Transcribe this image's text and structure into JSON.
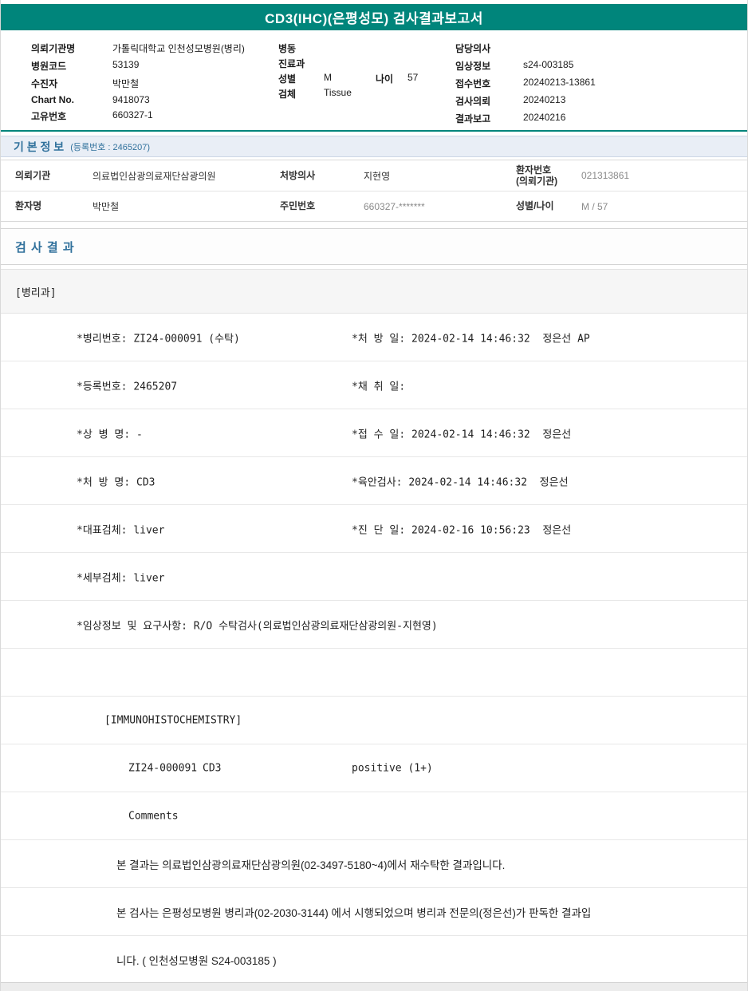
{
  "header": {
    "title": "CD3(IHC)(은평성모) 검사결과보고서",
    "accent_color": "#00857B"
  },
  "info": {
    "left": [
      {
        "label": "의뢰기관명",
        "value": "가톨릭대학교 인천성모병원(병리)"
      },
      {
        "label": "병원코드",
        "value": "53139"
      },
      {
        "label": "수진자",
        "value": "박만철"
      },
      {
        "label": "Chart No.",
        "value": "9418073"
      },
      {
        "label": "고유번호",
        "value": "660327-1"
      }
    ],
    "middle": [
      {
        "label": "병동",
        "value": ""
      },
      {
        "label": "진료과",
        "value": ""
      },
      {
        "label": "성별",
        "value": "M",
        "label2": "나이",
        "value2": "57"
      },
      {
        "label": "검체",
        "value": "Tissue"
      }
    ],
    "right": [
      {
        "label": "담당의사",
        "value": ""
      },
      {
        "label": "임상정보",
        "value": "s24-003185"
      },
      {
        "label": "접수번호",
        "value": "20240213-13861"
      },
      {
        "label": "검사의뢰",
        "value": "20240213"
      },
      {
        "label": "결과보고",
        "value": "20240216"
      }
    ]
  },
  "basic_info": {
    "title": "기 본 정 보",
    "subtitle": "(등록번호 : 2465207)",
    "rows": [
      [
        {
          "label": "의뢰기관",
          "value": "의료법인삼광의료재단삼광의원"
        },
        {
          "label": "처방의사",
          "value": "지현영"
        },
        {
          "label": "환자번호\n(의뢰기관)",
          "value": "021313861"
        }
      ],
      [
        {
          "label": "환자명",
          "value": "박만철"
        },
        {
          "label": "주민번호",
          "value": "660327-*******"
        },
        {
          "label": "성별/나이",
          "value": "M / 57"
        }
      ]
    ]
  },
  "results": {
    "title": "검 사 결 과",
    "department": "[병리과]",
    "detail_rows": [
      {
        "left": "*병리번호: ZI24-000091 (수탁)",
        "right": "*처 방 일: 2024-02-14 14:46:32  정은선 AP"
      },
      {
        "left": "*등록번호: 2465207",
        "right": "*채 취 일:"
      },
      {
        "left": "*상 병 명: -",
        "right": "*접 수 일: 2024-02-14 14:46:32  정은선"
      },
      {
        "left": "*처 방 명: CD3",
        "right": "*육안검사: 2024-02-14 14:46:32  정은선"
      },
      {
        "left": "*대표검체: liver",
        "right": "*진 단 일: 2024-02-16 10:56:23  정은선"
      },
      {
        "left": "*세부검체: liver",
        "right": ""
      },
      {
        "left": "*임상정보 및 요구사항: R/O 수탁검사(의료법인삼광의료재단삼광의원-지현영)",
        "right": ""
      },
      {
        "left": "",
        "right": ""
      }
    ],
    "section_label": "[IMMUNOHISTOCHEMISTRY]",
    "result_line": {
      "specimen": "ZI24-000091",
      "test": "CD3",
      "result": "positive (1+)"
    },
    "comments_label": "Comments",
    "comment_lines": [
      "본 결과는 의료법인삼광의료재단삼광의원(02-3497-5180~4)에서 재수탁한 결과입니다.",
      "본 검사는 은평성모병원 병리과(02-2030-3144) 에서 시행되었으며 병리과 전문의(정은선)가 판독한 결과입",
      "니다. ( 인천성모병원 S24-003185 )"
    ]
  }
}
